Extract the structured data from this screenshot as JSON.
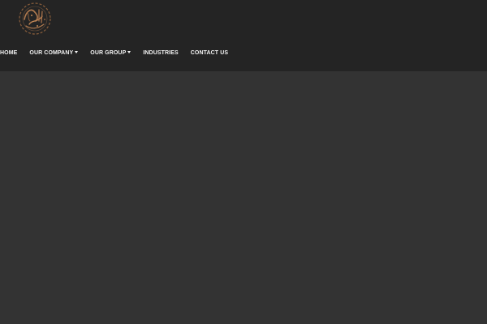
{
  "header": {
    "logo_icon": "arabic-calligraphy-logo-icon",
    "logo_color": "#b07a4f"
  },
  "nav": {
    "items": [
      {
        "label": "HOME",
        "dropdown": false
      },
      {
        "label": "OUR COMPANY",
        "dropdown": true
      },
      {
        "label": "OUR GROUP",
        "dropdown": true
      },
      {
        "label": "INDUSTRIES",
        "dropdown": false
      },
      {
        "label": "CONTACT US",
        "dropdown": false
      }
    ]
  },
  "colors": {
    "header_bg": "#242424",
    "page_bg": "#333333",
    "nav_text": "#f2f2f2"
  }
}
